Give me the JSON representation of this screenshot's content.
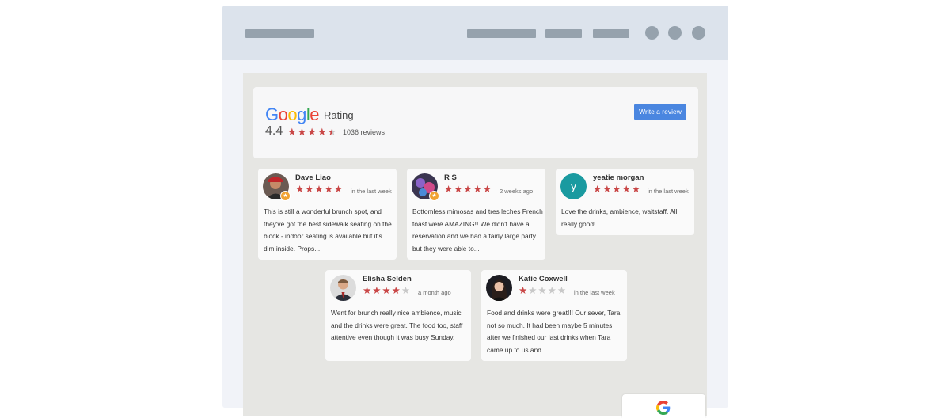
{
  "widget": {
    "logo_text": "Google",
    "rating_label": "Rating",
    "score": "4.4",
    "reviews_count": "1036 reviews",
    "write_review_label": "Write a review"
  },
  "reviews": [
    {
      "name": "Dave Liao",
      "rating": 5,
      "when": "in the last week",
      "text": "This is still a wonderful brunch spot, and they've got the best sidewalk seating on the block - indoor seating is available but it's dim inside. Props..."
    },
    {
      "name": "R S",
      "rating": 5,
      "when": "2 weeks ago",
      "text": "Bottomless mimosas and tres leches French toast were AMAZING!! We didn't have a reservation and we had a fairly large party but they were able to..."
    },
    {
      "name": "yeatie morgan",
      "rating": 5,
      "when": "in the last week",
      "initial": "y",
      "text": "Love the drinks, ambience, waitstaff. All really good!"
    },
    {
      "name": "Elisha Selden",
      "rating": 4,
      "when": "a month ago",
      "text": "Went for brunch really nice ambience, music and the drinks were great. The food too, staff attentive even though it was busy Sunday."
    },
    {
      "name": "Katie Coxwell",
      "rating": 1,
      "when": "in the last week",
      "text": "Food and drinks were great!!! Our sever, Tara, not so much. It had been maybe 5 minutes after we finished our last drinks when Tara came up to us and..."
    }
  ],
  "colors": {
    "star": "#c94646",
    "button": "#4a86e0",
    "avatar_teal": "#1a9aa0"
  }
}
